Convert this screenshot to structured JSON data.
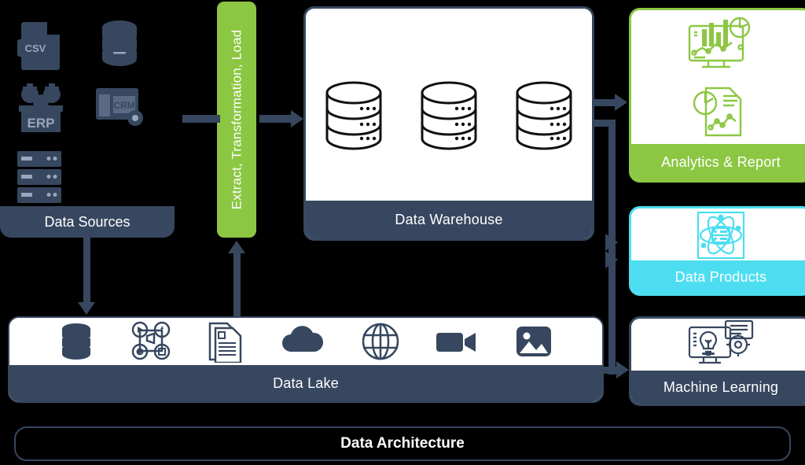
{
  "diagram": {
    "title": "Data Architecture",
    "colors": {
      "navy": "#37475F",
      "green": "#8CC743",
      "cyan": "#4CDEF0",
      "white": "#FFFFFF",
      "background": "#000000"
    }
  },
  "data_sources": {
    "label": "Data Sources",
    "icons": [
      {
        "name": "csv-file-icon",
        "caption": "CSV"
      },
      {
        "name": "database-icon",
        "caption": ""
      },
      {
        "name": "erp-icon",
        "caption": "ERP"
      },
      {
        "name": "crm-icon",
        "caption": "CRM"
      },
      {
        "name": "server-rack-icon",
        "caption": ""
      }
    ]
  },
  "etl": {
    "label": "Extract, Transformation, Load"
  },
  "data_warehouse": {
    "label": "Data Warehouse",
    "icons": [
      {
        "name": "database-cylinder-icon"
      },
      {
        "name": "database-cylinder-icon"
      },
      {
        "name": "database-cylinder-icon"
      }
    ]
  },
  "data_lake": {
    "label": "Data Lake",
    "icons": [
      {
        "name": "database-icon"
      },
      {
        "name": "social-media-icon"
      },
      {
        "name": "documents-icon"
      },
      {
        "name": "cloud-icon"
      },
      {
        "name": "globe-icon"
      },
      {
        "name": "video-camera-icon"
      },
      {
        "name": "image-icon"
      }
    ]
  },
  "outputs": [
    {
      "label": "Analytics & Report",
      "accent": "#8CC743",
      "icons": [
        {
          "name": "dashboard-monitor-icon"
        },
        {
          "name": "report-document-icon"
        }
      ]
    },
    {
      "label": "Data Products",
      "accent": "#4CDEF0",
      "icons": [
        {
          "name": "atom-server-icon"
        }
      ]
    },
    {
      "label": "Machine Learning",
      "accent": "#37475F",
      "icons": [
        {
          "name": "ml-monitor-lightbulb-gear-icon"
        }
      ]
    }
  ]
}
